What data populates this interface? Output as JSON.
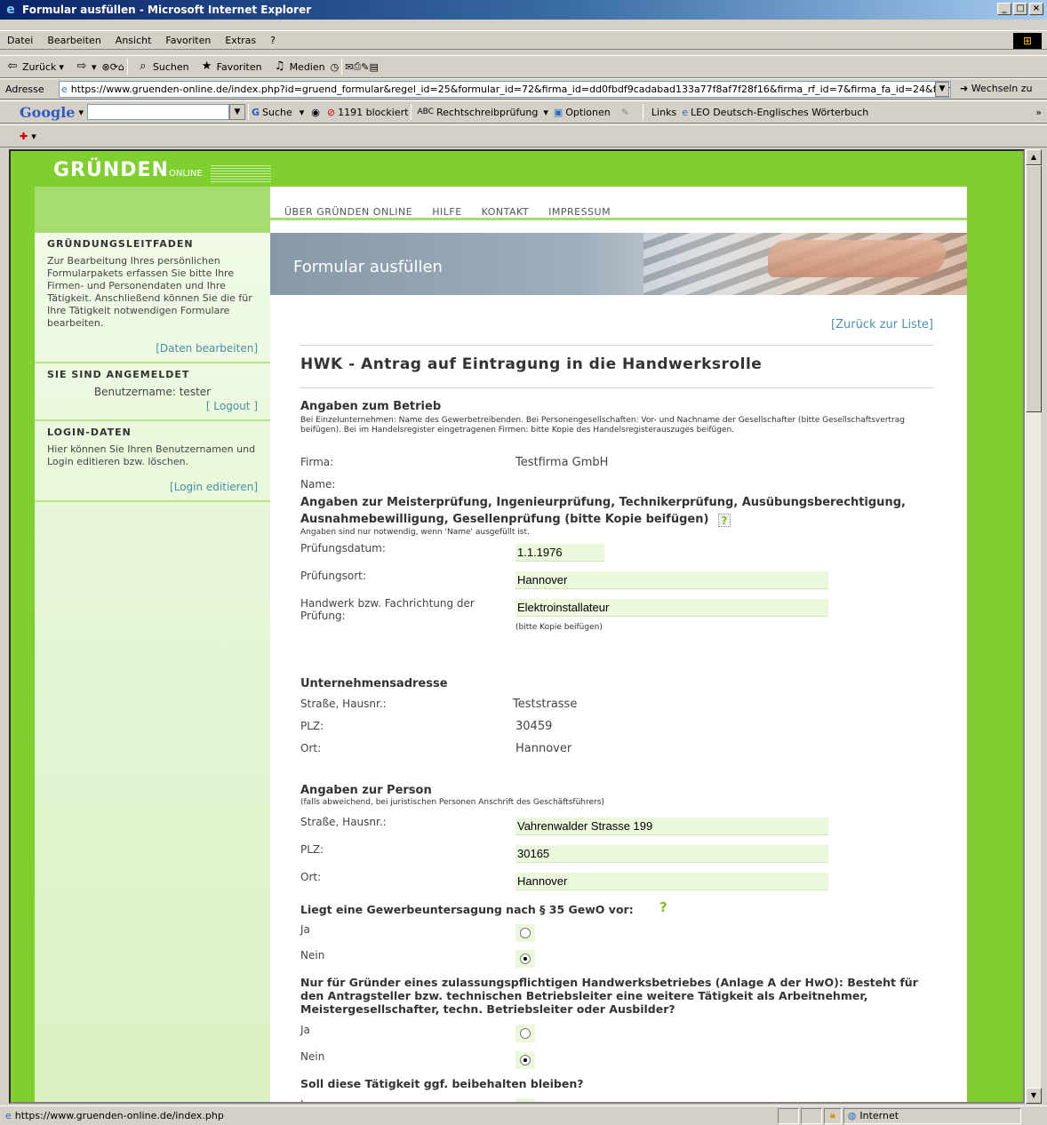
{
  "window": {
    "title": "Formular ausfüllen - Microsoft Internet Explorer",
    "controls": [
      "_",
      "□",
      "×"
    ]
  },
  "menu": [
    "Datei",
    "Bearbeiten",
    "Ansicht",
    "Favoriten",
    "Extras",
    "?"
  ],
  "toolbar": {
    "back": "Zurück",
    "search": "Suchen",
    "favorites": "Favoriten",
    "media": "Medien"
  },
  "address": {
    "label": "Adresse",
    "url": "https://www.gruenden-online.de/index.php?id=gruend_formular&regel_id=25&formular_id=72&firma_id=dd0fbdf9cadabad133a77f8af7f28f16&firma_rf_id=7&firma_fa_id=24&firm",
    "go": "Wechseln zu"
  },
  "google_bar": {
    "logo": "Google",
    "search": "Suche",
    "blocked": "1191 blockiert",
    "spellcheck": "Rechtschreibprüfung",
    "options": "Optionen",
    "links": "Links",
    "leo": "LEO Deutsch-Englisches Wörterbuch"
  },
  "site": {
    "logo_main": "GRÜNDEN",
    "logo_sub": "ONLINE",
    "nav": [
      "ÜBER GRÜNDEN ONLINE",
      "HILFE",
      "KONTAKT",
      "IMPRESSUM"
    ],
    "banner_title": "Formular ausfüllen"
  },
  "sidebar": {
    "guide_title": "GRÜNDUNGSLEITFADEN",
    "guide_text": "Zur Bearbeitung Ihres persönlichen Formularpakets erfassen Sie bitte Ihre Firmen- und Personendaten und Ihre Tätigkeit. Anschließend können Sie die für Ihre Tätigkeit notwendigen Formulare bearbeiten.",
    "guide_link": "[Daten bearbeiten]",
    "logged_title": "SIE SIND ANGEMELDET",
    "username": "Benutzername: tester",
    "logout": "[ Logout ]",
    "login_title": "LOGIN-DATEN",
    "login_text": "Hier können Sie Ihren Benutzernamen und Login editieren bzw. löschen.",
    "login_link": "[Login editieren]"
  },
  "form": {
    "back_link": "[Zurück zur Liste]",
    "title": "HWK - Antrag auf Eintragung in die Handwerksrolle",
    "betrieb": {
      "title": "Angaben zum Betrieb",
      "note": "Bei Einzelunternehmen: Name des Gewerbetreibenden. Bei Personengesellschaften: Vor- und Nachname der Gesellschafter (bitte Gesellschaftsvertrag beifügen). Bei im Handelsregister eingetragenen Firmen: bitte Kopie des Handelsregisterauszuges beifügen.",
      "firma_label": "Firma:",
      "firma_value": "Testfirma GmbH",
      "name_label": "Name:"
    },
    "pruefung": {
      "title": "Angaben zur Meisterprüfung, Ingenieurprüfung, Technikerprüfung, Ausübungsberechtigung, Ausnahmebewilligung, Gesellenprüfung (bitte Kopie beifügen)",
      "note": "Angaben sind nur notwendig, wenn 'Name' ausgefüllt ist.",
      "datum_label": "Prüfungsdatum:",
      "datum_value": "1.1.1976",
      "ort_label": "Prüfungsort:",
      "ort_value": "Hannover",
      "handwerk_label": "Handwerk bzw. Fachrichtung der Prüfung:",
      "handwerk_value": "Elektroinstallateur",
      "handwerk_note": "(bitte Kopie beifügen)"
    },
    "adresse": {
      "title": "Unternehmensadresse",
      "strasse_label": "Straße, Hausnr.:",
      "strasse_value": "Teststrasse",
      "plz_label": "PLZ:",
      "plz_value": "30459",
      "ort_label": "Ort:",
      "ort_value": "Hannover"
    },
    "person": {
      "title": "Angaben zur Person",
      "note": "(falls abweichend, bei juristischen Personen Anschrift des Geschäftsführers)",
      "strasse_label": "Straße, Hausnr.:",
      "strasse_value": "Vahrenwalder Strasse 199",
      "plz_label": "PLZ:",
      "plz_value": "30165",
      "ort_label": "Ort:",
      "ort_value": "Hannover"
    },
    "q1": {
      "text": "Liegt eine Gewerbeuntersagung nach § 35 GewO vor:",
      "yes": "Ja",
      "no": "Nein",
      "selected": "Nein"
    },
    "q2": {
      "text": "Nur für Gründer eines zulassungspflichtigen Handwerksbetriebes (Anlage A der HwO): Besteht für den Antragsteller bzw. technischen Betriebsleiter eine weitere Tätigkeit als Arbeitnehmer, Meistergesellschafter, techn. Betriebsleiter oder Ausbilder?",
      "yes": "Ja",
      "no": "Nein",
      "selected": "Nein"
    },
    "q3": {
      "text": "Soll diese Tätigkeit ggf. beibehalten bleiben?",
      "yes": "Ja"
    }
  },
  "status": {
    "url": "https://www.gruenden-online.de/index.php",
    "zone": "Internet"
  }
}
